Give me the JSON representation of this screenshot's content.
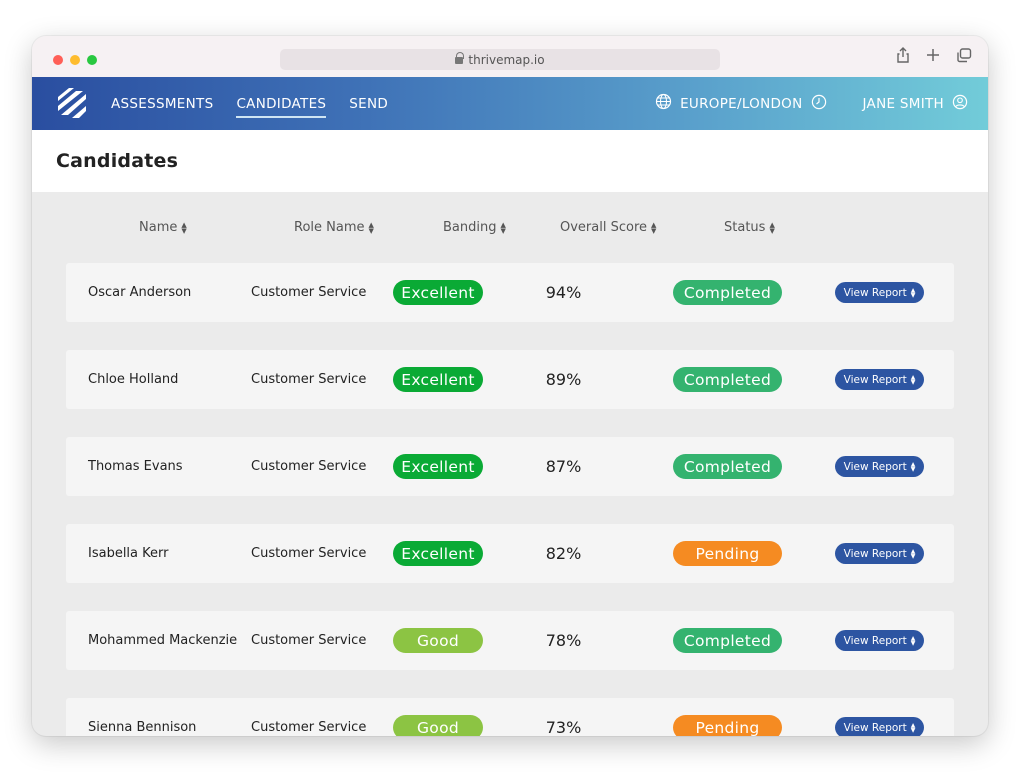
{
  "browser": {
    "url": "thrivemap.io"
  },
  "nav": {
    "items": [
      {
        "label": "ASSESSMENTS",
        "active": false
      },
      {
        "label": "CANDIDATES",
        "active": true
      },
      {
        "label": "SEND",
        "active": false
      }
    ],
    "timezone": "EUROPE/LONDON",
    "user": "JANE SMITH"
  },
  "page": {
    "title": "Candidates"
  },
  "table": {
    "columns": [
      "Name",
      "Role Name",
      "Banding",
      "Overall Score",
      "Status"
    ],
    "action_label": "View Report",
    "rows": [
      {
        "name": "Oscar Anderson",
        "role": "Customer Service",
        "banding": "Excellent",
        "score": "94%",
        "status": "Completed"
      },
      {
        "name": "Chloe Holland",
        "role": "Customer Service",
        "banding": "Excellent",
        "score": "89%",
        "status": "Completed"
      },
      {
        "name": "Thomas Evans",
        "role": "Customer Service",
        "banding": "Excellent",
        "score": "87%",
        "status": "Completed"
      },
      {
        "name": "Isabella Kerr",
        "role": "Customer Service",
        "banding": "Excellent",
        "score": "82%",
        "status": "Pending"
      },
      {
        "name": "Mohammed Mackenzie",
        "role": "Customer Service",
        "banding": "Good",
        "score": "78%",
        "status": "Completed"
      },
      {
        "name": "Sienna Bennison",
        "role": "Customer Service",
        "banding": "Good",
        "score": "73%",
        "status": "Pending"
      }
    ]
  },
  "colors": {
    "excellent": "#0aaa35",
    "good": "#8cc443",
    "completed": "#34b36f",
    "pending": "#f58b22",
    "action": "#2d55a2"
  }
}
